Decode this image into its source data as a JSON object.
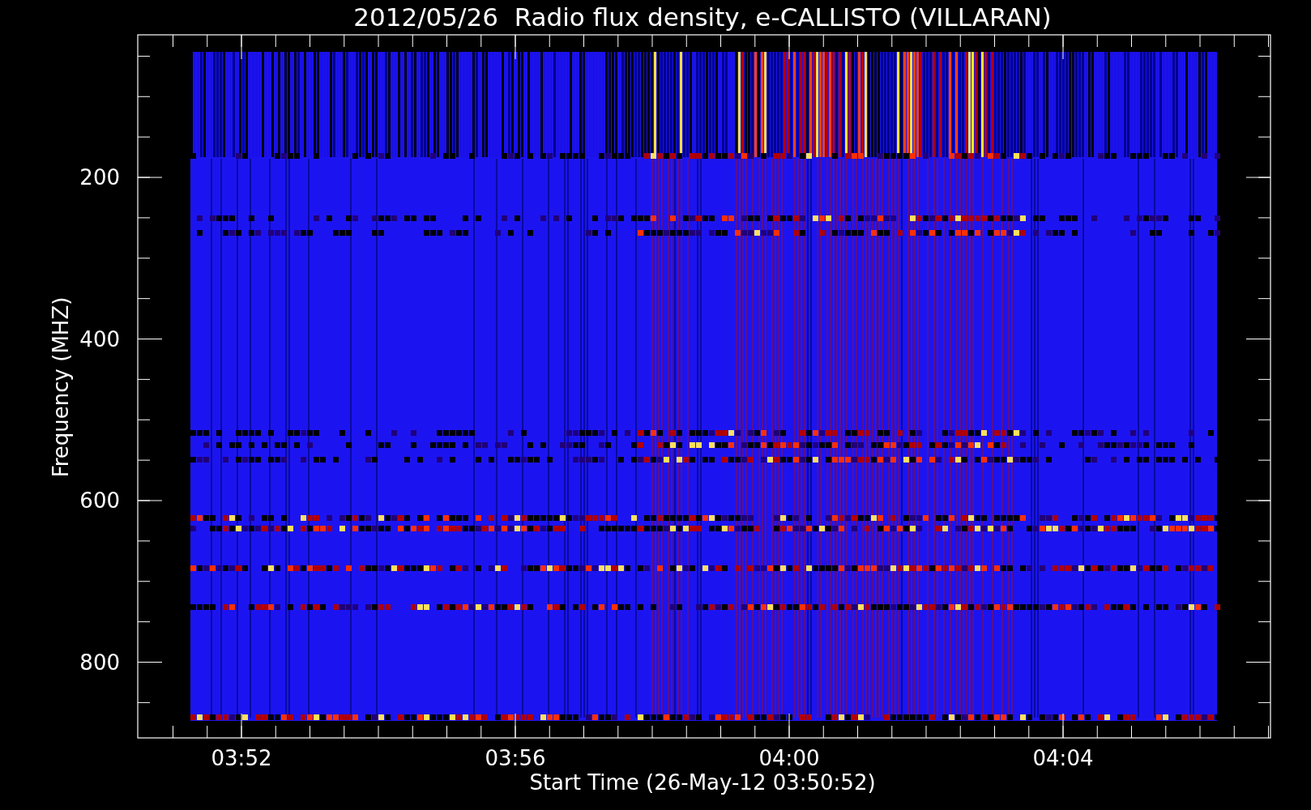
{
  "title": "2012/05/26  Radio flux density, e-CALLISTO (VILLARAN)",
  "y_axis": {
    "label": "Frequency (MHZ)",
    "ticks": [
      "200",
      "400",
      "600",
      "800"
    ]
  },
  "x_axis": {
    "label": "Start Time (26-May-12 03:50:52)",
    "ticks": [
      "03:52",
      "03:56",
      "04:00",
      "04:04"
    ]
  }
}
